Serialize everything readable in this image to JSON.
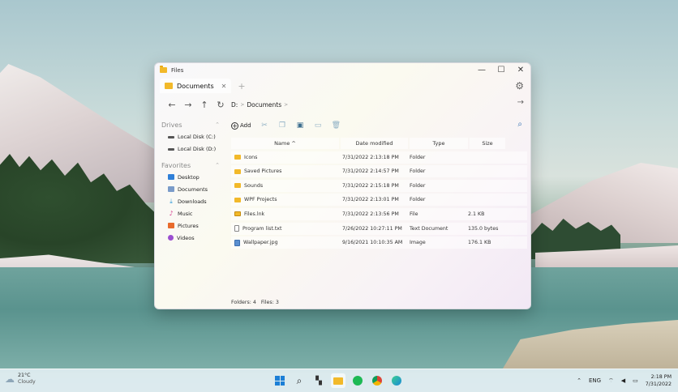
{
  "window": {
    "title": "Files",
    "minimize_glyph": "—",
    "maximize_glyph": "☐",
    "close_glyph": "✕"
  },
  "tabs": [
    {
      "label": "Documents",
      "close_glyph": "✕",
      "active": true
    }
  ],
  "tab_add_glyph": "+",
  "nav": {
    "back_glyph": "←",
    "forward_glyph": "→",
    "up_glyph": "↑",
    "refresh_glyph": "↻"
  },
  "sidebar": {
    "drives_label": "Drives",
    "drives": [
      {
        "label": "Local Disk (C:)"
      },
      {
        "label": "Local Disk (D:)"
      }
    ],
    "favorites_label": "Favorites",
    "favorites": [
      {
        "label": "Desktop",
        "icon": "desktop-icon"
      },
      {
        "label": "Documents",
        "icon": "documents-icon"
      },
      {
        "label": "Downloads",
        "icon": "downloads-icon"
      },
      {
        "label": "Music",
        "icon": "music-icon"
      },
      {
        "label": "Pictures",
        "icon": "pictures-icon"
      },
      {
        "label": "Videos",
        "icon": "videos-icon"
      }
    ]
  },
  "address": {
    "root": "D:",
    "crumb": "Documents",
    "sep": ">"
  },
  "toolbar": {
    "add_label": "Add"
  },
  "table": {
    "headers": {
      "name": "Name",
      "date": "Date modified",
      "type": "Type",
      "size": "Size"
    },
    "sort_glyph": "^",
    "rows": [
      {
        "name": "Icons",
        "date": "7/31/2022 2:13:18 PM",
        "type": "Folder",
        "size": "",
        "kind": "folder"
      },
      {
        "name": "Saved Pictures",
        "date": "7/31/2022 2:14:57 PM",
        "type": "Folder",
        "size": "",
        "kind": "folder"
      },
      {
        "name": "Sounds",
        "date": "7/31/2022 2:15:18 PM",
        "type": "Folder",
        "size": "",
        "kind": "folder"
      },
      {
        "name": "WPF Projects",
        "date": "7/31/2022 2:13:01 PM",
        "type": "Folder",
        "size": "",
        "kind": "folder"
      },
      {
        "name": "Files.lnk",
        "date": "7/31/2022 2:13:56 PM",
        "type": "File",
        "size": "2.1 KB",
        "kind": "link"
      },
      {
        "name": "Program list.txt",
        "date": "7/26/2022 10:27:11 PM",
        "type": "Text Document",
        "size": "135.0 bytes",
        "kind": "text"
      },
      {
        "name": "Wallpaper.jpg",
        "date": "9/16/2021 10:10:35 AM",
        "type": "Image",
        "size": "176.1 KB",
        "kind": "image"
      }
    ]
  },
  "status": {
    "folders": "Folders: 4",
    "files": "Files: 3"
  },
  "taskbar": {
    "temperature": "21°C",
    "condition": "Cloudy",
    "language": "ENG",
    "time": "2:18 PM",
    "date": "7/31/2022"
  }
}
